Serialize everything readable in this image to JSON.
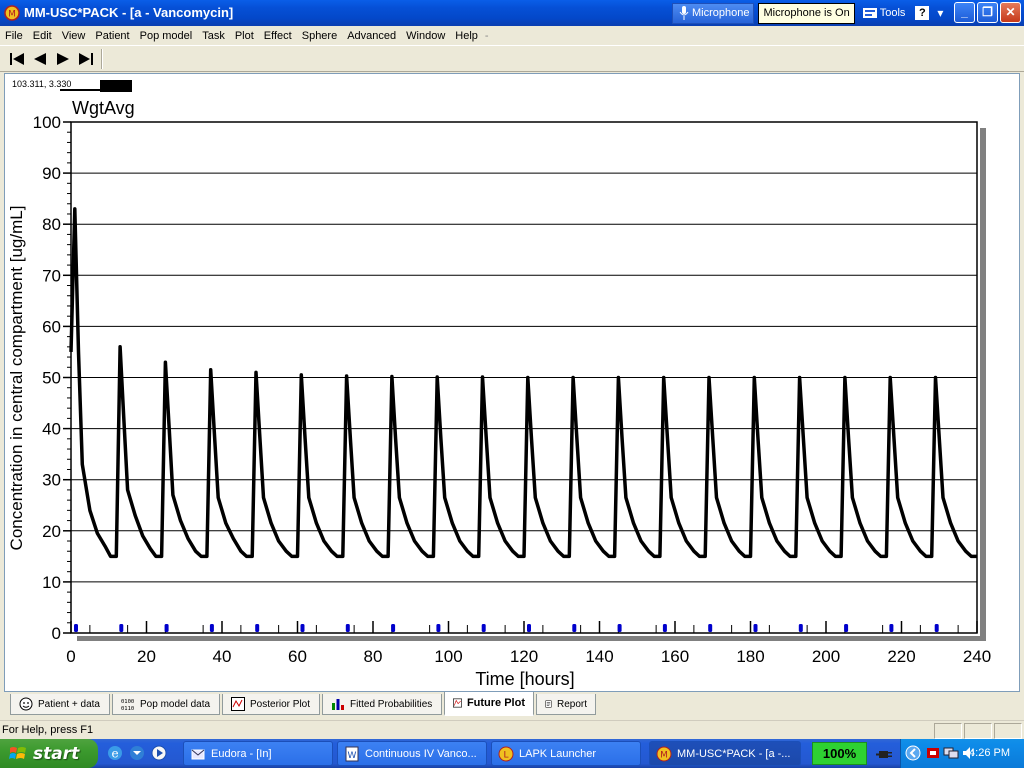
{
  "window": {
    "title": "MM-USC*PACK - [a - Vancomycin]",
    "caption_buttons": [
      "minimize",
      "maximize",
      "close"
    ]
  },
  "language_bar": {
    "microphone_label": "Microphone",
    "tooltip": "Microphone is On",
    "tools_label": "Tools",
    "help_label": "?"
  },
  "menu": [
    "File",
    "Edit",
    "View",
    "Patient",
    "Pop model",
    "Task",
    "Plot",
    "Effect",
    "Sphere",
    "Advanced",
    "Window",
    "Help"
  ],
  "toolbar": {
    "buttons": [
      "first-icon",
      "previous-icon",
      "next-icon",
      "last-icon"
    ]
  },
  "plot": {
    "coords_readout": "103.311, 3.330"
  },
  "chart_data": {
    "type": "line",
    "title": "WgtAvg",
    "xlabel": "Time [hours]",
    "ylabel": "Concentration in central compartment [ug/mL]",
    "xlim": [
      0,
      240
    ],
    "ylim": [
      0,
      100
    ],
    "xticks": [
      0,
      20,
      40,
      60,
      80,
      100,
      120,
      140,
      160,
      180,
      200,
      220,
      240
    ],
    "yticks": [
      0,
      10,
      20,
      30,
      40,
      50,
      60,
      70,
      80,
      90,
      100
    ],
    "grid": "horizontal",
    "line_color": "#000000",
    "marker_color": "#0000cc",
    "series": [
      {
        "x": [
          0,
          1,
          2,
          3,
          5,
          7,
          9,
          10.5,
          12,
          13,
          14,
          15,
          17,
          19,
          21,
          22.5,
          24,
          25,
          26,
          27,
          29,
          31,
          33,
          34.5,
          36,
          37,
          38,
          39,
          41,
          43,
          45,
          46.5,
          48,
          49,
          50,
          51,
          53,
          55,
          57,
          58.5,
          60,
          61,
          62,
          63,
          65,
          67,
          69,
          70.5,
          72,
          73,
          74,
          75,
          77,
          79,
          81,
          82.5,
          84,
          85,
          86,
          87,
          89,
          91,
          93,
          94.5,
          96,
          97,
          98,
          99,
          101,
          103,
          105,
          106.5,
          108,
          109,
          110,
          111,
          113,
          115,
          117,
          118.5,
          120,
          121,
          122,
          123,
          125,
          127,
          129,
          130.5,
          132,
          133,
          134,
          135,
          137,
          139,
          141,
          142.5,
          144,
          145,
          146,
          147,
          149,
          151,
          153,
          154.5,
          156,
          157,
          158,
          159,
          161,
          163,
          165,
          166.5,
          168,
          169,
          170,
          171,
          173,
          175,
          177,
          178.5,
          180,
          181,
          182,
          183,
          185,
          187,
          189,
          190.5,
          192,
          193,
          194,
          195,
          197,
          199,
          201,
          202.5,
          204,
          205,
          206,
          207,
          209,
          211,
          213,
          214.5,
          216,
          217,
          218,
          219,
          221,
          223,
          225,
          226.5,
          228,
          229,
          230,
          231,
          233,
          235,
          237,
          238.5,
          240
        ],
        "y": [
          55,
          83,
          55,
          33,
          24,
          19.5,
          17,
          15,
          15,
          56,
          42,
          28,
          23,
          19,
          16.5,
          15,
          15,
          53,
          40,
          27,
          22,
          18.5,
          16,
          15,
          15,
          51.5,
          39,
          26.5,
          21.5,
          18.5,
          16,
          15,
          15,
          51,
          38.5,
          26.5,
          21.5,
          18,
          16,
          15,
          15,
          50.5,
          38,
          26.5,
          21.5,
          18,
          16,
          15,
          15,
          50.3,
          38,
          26.5,
          21.5,
          18,
          16,
          15,
          15,
          50.2,
          38,
          26.5,
          21.5,
          18,
          16,
          15,
          15,
          50.1,
          38,
          26.5,
          21.5,
          18,
          16,
          15,
          15,
          50.1,
          38,
          26.5,
          21.5,
          18,
          16,
          15,
          15,
          50,
          38,
          26.5,
          21.5,
          18,
          16,
          15,
          15,
          50,
          38,
          26.5,
          21.5,
          18,
          16,
          15,
          15,
          50,
          38,
          26.5,
          21.5,
          18,
          16,
          15,
          15,
          50,
          38,
          26.5,
          21.5,
          18,
          16,
          15,
          15,
          50,
          38,
          26.5,
          21.5,
          18,
          16,
          15,
          15,
          50,
          38,
          26.5,
          21.5,
          18,
          16,
          15,
          15,
          50,
          38,
          26.5,
          21.5,
          18,
          16,
          15,
          15,
          50,
          38,
          26.5,
          21.5,
          18,
          16,
          15,
          15,
          50,
          38,
          26.5,
          21.5,
          18,
          16,
          15,
          15,
          50,
          38,
          26.5,
          21.5,
          18,
          16,
          15,
          15
        ]
      }
    ],
    "dose_markers_x": [
      0,
      12,
      24,
      36,
      48,
      60,
      72,
      84,
      96,
      108,
      120,
      132,
      144,
      156,
      168,
      180,
      192,
      204,
      216,
      228
    ]
  },
  "tabs": [
    {
      "label": "Patient + data",
      "icon": "patient-icon",
      "active": false
    },
    {
      "label": "Pop model data",
      "icon": "binary-data-icon",
      "active": false
    },
    {
      "label": "Posterior Plot",
      "icon": "posterior-plot-icon",
      "active": false
    },
    {
      "label": "Fitted Probabilities",
      "icon": "bar-chart-icon",
      "active": false
    },
    {
      "label": "Future Plot",
      "icon": "future-plot-icon",
      "active": true
    },
    {
      "label": "Report",
      "icon": "report-icon",
      "active": false
    }
  ],
  "status": {
    "text": "For Help, press F1"
  },
  "taskbar": {
    "start_label": "start",
    "tasks": [
      {
        "label": "Eudora - [In]",
        "icon": "eudora-icon",
        "active": false
      },
      {
        "label": "Continuous IV Vanco...",
        "icon": "word-doc-icon",
        "active": false
      },
      {
        "label": "LAPK Launcher",
        "icon": "lapk-icon",
        "active": false
      },
      {
        "label": "MM-USC*PACK - [a -...",
        "icon": "mm-usc-icon",
        "active": true
      }
    ],
    "zoom": "100%",
    "clock": "4:26 PM"
  }
}
